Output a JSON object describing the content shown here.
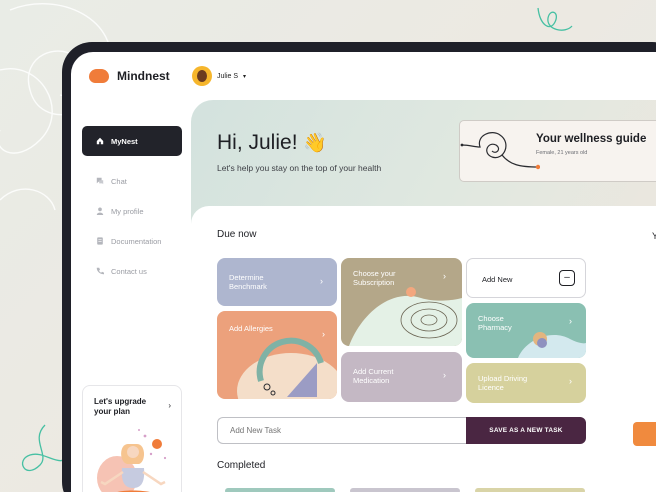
{
  "app": {
    "name": "Mindnest"
  },
  "user": {
    "name": "Julie S",
    "caret": "▾"
  },
  "sidebar": {
    "items": [
      {
        "label": "MyNest",
        "icon": "home-icon"
      },
      {
        "label": "Chat",
        "icon": "chat-icon"
      },
      {
        "label": "My profile",
        "icon": "user-icon"
      },
      {
        "label": "Documentation",
        "icon": "document-icon"
      },
      {
        "label": "Contact us",
        "icon": "phone-icon"
      }
    ],
    "upgrade": {
      "text": "Let's upgrade your plan",
      "arrow": "›"
    }
  },
  "hero": {
    "greeting": "Hi, Julie!",
    "wave": "👋",
    "subtitle": "Let's help you stay on the top of your health"
  },
  "guide": {
    "title": "Your wellness guide",
    "subtitle": "Female, 21 years old"
  },
  "due": {
    "title": "Due now",
    "cards": [
      {
        "label": "Determine Benchmark",
        "color": "#aeb6cf"
      },
      {
        "label": "Choose your Subscription",
        "color": "#b4a789"
      },
      {
        "label": "Add Allergies",
        "color": "#eca17c"
      },
      {
        "label": "Add Current Medication",
        "color": "#c4b8c4"
      },
      {
        "label": "Choose Pharmacy",
        "color": "#8ac0b2"
      },
      {
        "label": "Upload Driving Licence",
        "color": "#d6d19d"
      }
    ],
    "arrow": "›",
    "add_new": {
      "label": "Add New",
      "button": "–"
    }
  },
  "task": {
    "placeholder": "Add New Task",
    "save": "SAVE AS A NEW TASK"
  },
  "completed": {
    "title": "Completed"
  },
  "peek": {
    "letter": "Y"
  },
  "colors": {
    "accent": "#f07c3a",
    "dark": "#22232a",
    "save": "#4a2642"
  }
}
